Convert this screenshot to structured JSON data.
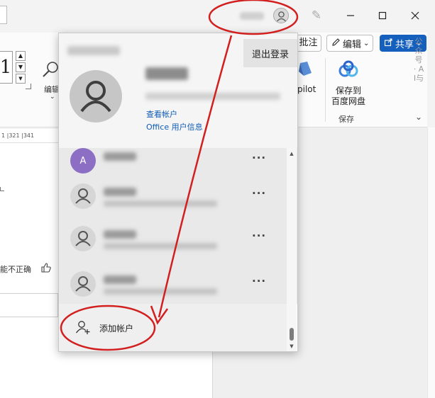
{
  "window": {
    "minimize_icon": "minimize-icon",
    "maximize_icon": "maximize-icon",
    "close_icon": "close-icon",
    "close_glyph": "✕"
  },
  "ribbon": {
    "font_size_value": "1",
    "edit_label": "编辑",
    "comment_label": "批注",
    "edit_button_label": "编辑",
    "share_button_label": "共享",
    "copilot_label": "pilot",
    "save_to_line1": "保存到",
    "save_to_line2": "百度网盘",
    "save_group_label": "保存",
    "watermark": "公众号 · AI与",
    "ruler_text": "1  |321  |341"
  },
  "document": {
    "feedback_text": "能不正确"
  },
  "account_popup": {
    "signout_label": "退出登录",
    "view_account_link": "查看帐户",
    "office_profile_link": "Office 用户信息",
    "accounts": [
      {
        "initial": "A",
        "avatar": "letter"
      },
      {
        "initial": "",
        "avatar": "person-icon"
      },
      {
        "initial": "",
        "avatar": "person-icon"
      },
      {
        "initial": "",
        "avatar": "person-icon"
      }
    ],
    "more_label": "···",
    "add_account_label": "添加帐户"
  },
  "colors": {
    "accent": "#1560bd",
    "annotation_red": "#d21f1f",
    "link_blue": "#0f5bb5"
  }
}
